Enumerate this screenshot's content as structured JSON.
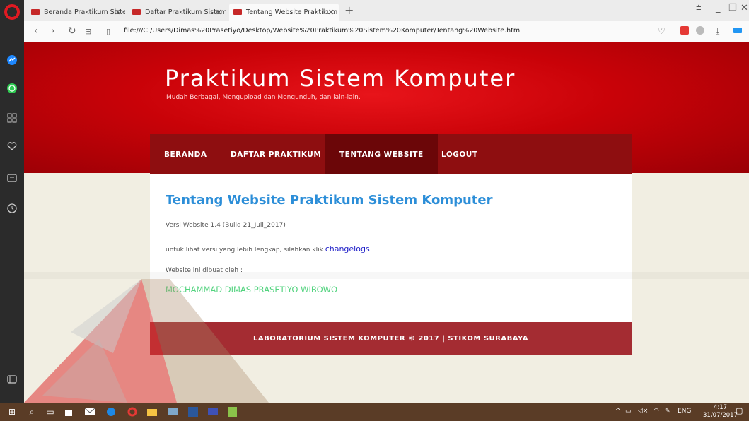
{
  "browser": {
    "tabs": [
      {
        "label": "Beranda Praktikum Sistem"
      },
      {
        "label": "Daftar Praktikum Sistem K"
      },
      {
        "label": "Tentang Website Praktikum"
      }
    ],
    "close_glyph": "✕",
    "new_tab_glyph": "+",
    "url": "file:///C:/Users/Dimas%20Prasetiyo/Desktop/Website%20Praktikum%20Sistem%20Komputer/Tentang%20Website.html"
  },
  "site": {
    "title": "Praktikum Sistem Komputer",
    "subtitle": "Mudah Berbagai, Mengupload dan Mengunduh, dan lain-lain.",
    "nav": [
      {
        "label": "BERANDA"
      },
      {
        "label": "DAFTAR PRAKTIKUM"
      },
      {
        "label": "TENTANG WEBSITE"
      },
      {
        "label": "LOGOUT"
      }
    ],
    "active_nav": "TENTANG WEBSITE"
  },
  "content": {
    "heading": "Tentang Website Praktikum Sistem Komputer",
    "version": "Versi Website 1.4 (Build 21_Juli_2017)",
    "more_prefix": "untuk lihat versi yang lebih lengkap, silahkan klik",
    "more_link": "changelogs",
    "author_label": "Website ini dibuat oleh :",
    "author_name": "MOCHAMMAD DIMAS PRASETIYO WIBOWO"
  },
  "footer": {
    "text": "LABORATORIUM SISTEM KOMPUTER © 2017 | STIKOM SURABAYA"
  },
  "taskbar": {
    "language": "ENG",
    "time": "4:17",
    "date": "31/07/2017"
  },
  "colors": {
    "header_red": "#c90208",
    "nav_bg": "#8e0e10",
    "heading_blue": "#2c8ed8",
    "author_green": "#53d37f",
    "footer_bg": "#a42c32"
  }
}
